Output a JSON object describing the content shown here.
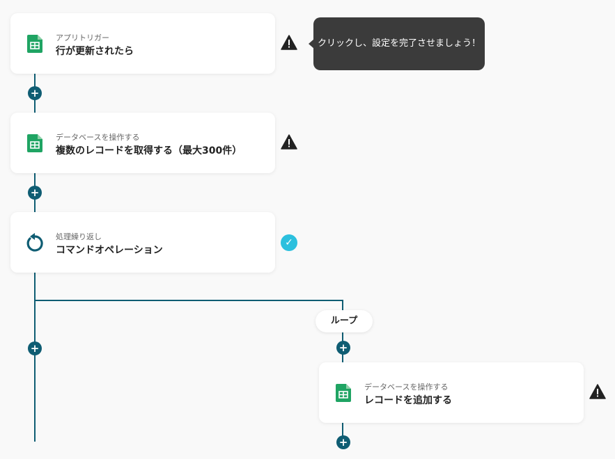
{
  "steps": [
    {
      "subtitle": "アプリトリガー",
      "title": "行が更新されたら",
      "icon": "google-sheets-icon",
      "status": "warning"
    },
    {
      "subtitle": "データベースを操作する",
      "title": "複数のレコードを取得する（最大300件）",
      "icon": "google-sheets-icon",
      "status": "warning"
    },
    {
      "subtitle": "処理繰り返し",
      "title": "コマンドオペレーション",
      "icon": "loop-icon",
      "status": "complete"
    },
    {
      "subtitle": "データベースを操作する",
      "title": "レコードを追加する",
      "icon": "google-sheets-icon",
      "status": "warning"
    }
  ],
  "tooltip": {
    "text": "クリックし、設定を完了させましょう！"
  },
  "loop": {
    "label": "ループ"
  },
  "add_button": {
    "glyph": "+"
  },
  "colors": {
    "connector": "#0f5d73",
    "check": "#2cc0de",
    "sheets": "#1fa463",
    "warning": "#222222",
    "tooltip_bg": "#3b3b3b"
  }
}
